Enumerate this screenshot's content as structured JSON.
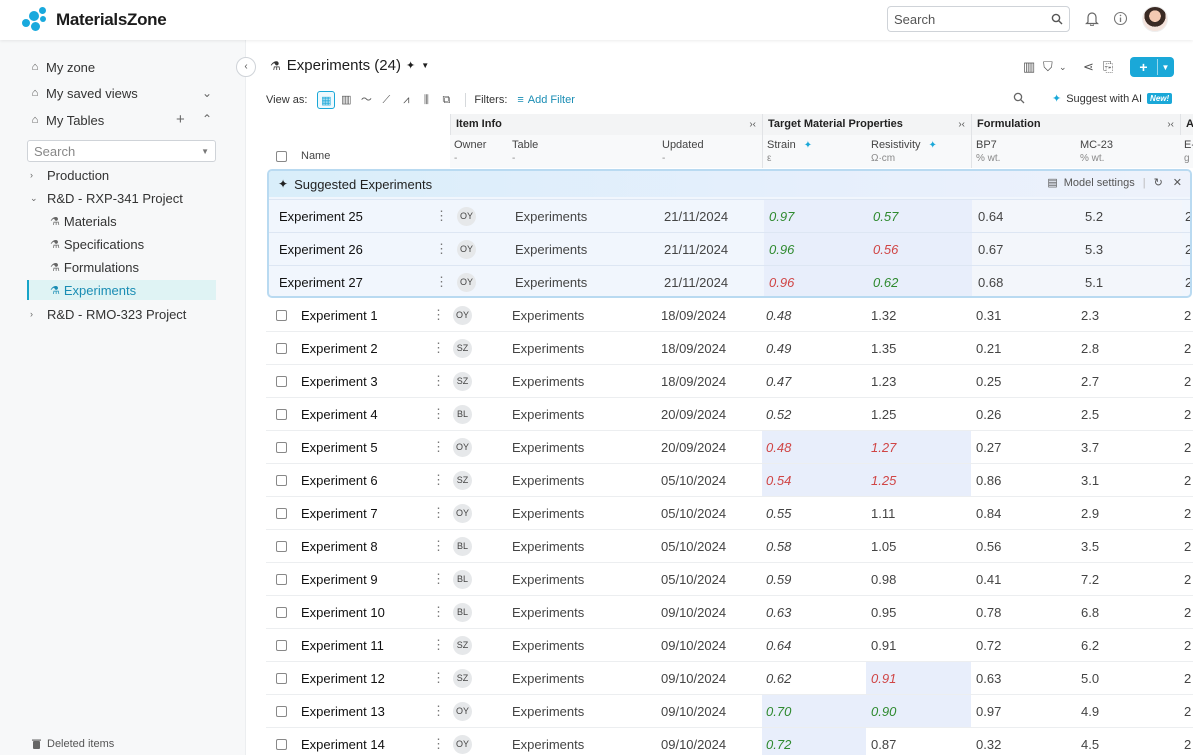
{
  "app": {
    "logo_text": "MaterialsZone"
  },
  "topbar": {
    "search_placeholder": "Search"
  },
  "sidebar": {
    "my_zone": "My zone",
    "saved_views": "My saved views",
    "my_tables": "My Tables",
    "search_placeholder": "Search",
    "tree": [
      {
        "label": "Production",
        "level": 0,
        "expanded": false
      },
      {
        "label": "R&D - RXP-341 Project",
        "level": 0,
        "expanded": true
      },
      {
        "label": "Materials",
        "level": 1
      },
      {
        "label": "Specifications",
        "level": 1
      },
      {
        "label": "Formulations",
        "level": 1
      },
      {
        "label": "Experiments",
        "level": 1,
        "active": true
      },
      {
        "label": "R&D - RMO-323 Project",
        "level": 0,
        "expanded": false
      }
    ],
    "deleted_items": "Deleted items"
  },
  "header": {
    "title": "Experiments (24)"
  },
  "toolbar": {
    "view_as": "View as:",
    "filters": "Filters:",
    "add_filter": "Add Filter",
    "suggest_ai": "Suggest with AI",
    "new_badge": "New!"
  },
  "groups": [
    {
      "label": "Item Info"
    },
    {
      "label": "Target Material Properties"
    },
    {
      "label": "Formulation"
    },
    {
      "label": "A"
    }
  ],
  "columns": [
    {
      "label": "Name",
      "sub": ""
    },
    {
      "label": "Owner",
      "sub": "-"
    },
    {
      "label": "Table",
      "sub": "-"
    },
    {
      "label": "Updated",
      "sub": "-"
    },
    {
      "label": "Strain",
      "sub": "ε"
    },
    {
      "label": "Resistivity",
      "sub": "Ω·cm"
    },
    {
      "label": "BP7",
      "sub": "% wt."
    },
    {
      "label": "MC-23",
      "sub": "% wt."
    },
    {
      "label": "E-",
      "sub": "g"
    }
  ],
  "suggested": {
    "title": "Suggested Experiments",
    "model_settings": "Model settings",
    "rows": [
      {
        "name": "Experiment 25",
        "owner": "OY",
        "table": "Experiments",
        "updated": "21/11/2024",
        "strain": "0.97",
        "resistivity": "0.57",
        "bp7": "0.64",
        "mc23": "5.2",
        "e": "2"
      },
      {
        "name": "Experiment 26",
        "owner": "OY",
        "table": "Experiments",
        "updated": "21/11/2024",
        "strain": "0.96",
        "resistivity": "0.56",
        "bp7": "0.67",
        "mc23": "5.3",
        "e": "2"
      },
      {
        "name": "Experiment 27",
        "owner": "OY",
        "table": "Experiments",
        "updated": "21/11/2024",
        "strain": "0.96",
        "resistivity": "0.62",
        "bp7": "0.68",
        "mc23": "5.1",
        "e": "2"
      }
    ]
  },
  "rows": [
    {
      "name": "Experiment 1",
      "owner": "OY",
      "table": "Experiments",
      "updated": "18/09/2024",
      "strain": "0.48",
      "resistivity": "1.32",
      "bp7": "0.31",
      "mc23": "2.3",
      "e": "2"
    },
    {
      "name": "Experiment 2",
      "owner": "SZ",
      "table": "Experiments",
      "updated": "18/09/2024",
      "strain": "0.49",
      "resistivity": "1.35",
      "bp7": "0.21",
      "mc23": "2.8",
      "e": "2"
    },
    {
      "name": "Experiment 3",
      "owner": "SZ",
      "table": "Experiments",
      "updated": "18/09/2024",
      "strain": "0.47",
      "resistivity": "1.23",
      "bp7": "0.25",
      "mc23": "2.7",
      "e": "2"
    },
    {
      "name": "Experiment 4",
      "owner": "BL",
      "table": "Experiments",
      "updated": "20/09/2024",
      "strain": "0.52",
      "resistivity": "1.25",
      "bp7": "0.26",
      "mc23": "2.5",
      "e": "2"
    },
    {
      "name": "Experiment 5",
      "owner": "OY",
      "table": "Experiments",
      "updated": "20/09/2024",
      "strain": "0.48",
      "resistivity": "1.27",
      "bp7": "0.27",
      "mc23": "3.7",
      "e": "2"
    },
    {
      "name": "Experiment 6",
      "owner": "SZ",
      "table": "Experiments",
      "updated": "05/10/2024",
      "strain": "0.54",
      "resistivity": "1.25",
      "bp7": "0.86",
      "mc23": "3.1",
      "e": "2"
    },
    {
      "name": "Experiment 7",
      "owner": "OY",
      "table": "Experiments",
      "updated": "05/10/2024",
      "strain": "0.55",
      "resistivity": "1.11",
      "bp7": "0.84",
      "mc23": "2.9",
      "e": "2"
    },
    {
      "name": "Experiment 8",
      "owner": "BL",
      "table": "Experiments",
      "updated": "05/10/2024",
      "strain": "0.58",
      "resistivity": "1.05",
      "bp7": "0.56",
      "mc23": "3.5",
      "e": "2"
    },
    {
      "name": "Experiment 9",
      "owner": "BL",
      "table": "Experiments",
      "updated": "05/10/2024",
      "strain": "0.59",
      "resistivity": "0.98",
      "bp7": "0.41",
      "mc23": "7.2",
      "e": "2"
    },
    {
      "name": "Experiment 10",
      "owner": "BL",
      "table": "Experiments",
      "updated": "09/10/2024",
      "strain": "0.63",
      "resistivity": "0.95",
      "bp7": "0.78",
      "mc23": "6.8",
      "e": "2"
    },
    {
      "name": "Experiment 11",
      "owner": "SZ",
      "table": "Experiments",
      "updated": "09/10/2024",
      "strain": "0.64",
      "resistivity": "0.91",
      "bp7": "0.72",
      "mc23": "6.2",
      "e": "2"
    },
    {
      "name": "Experiment 12",
      "owner": "SZ",
      "table": "Experiments",
      "updated": "09/10/2024",
      "strain": "0.62",
      "resistivity": "0.91",
      "bp7": "0.63",
      "mc23": "5.0",
      "e": "2"
    },
    {
      "name": "Experiment 13",
      "owner": "OY",
      "table": "Experiments",
      "updated": "09/10/2024",
      "strain": "0.70",
      "resistivity": "0.90",
      "bp7": "0.97",
      "mc23": "4.9",
      "e": "2"
    },
    {
      "name": "Experiment 14",
      "owner": "OY",
      "table": "Experiments",
      "updated": "09/10/2024",
      "strain": "0.72",
      "resistivity": "0.87",
      "bp7": "0.32",
      "mc23": "4.5",
      "e": "2"
    }
  ],
  "colors": {
    "accent": "#1aa8d8",
    "good": "#2f8a2f",
    "bad": "#d04545",
    "highlight": "#e8eefb"
  }
}
